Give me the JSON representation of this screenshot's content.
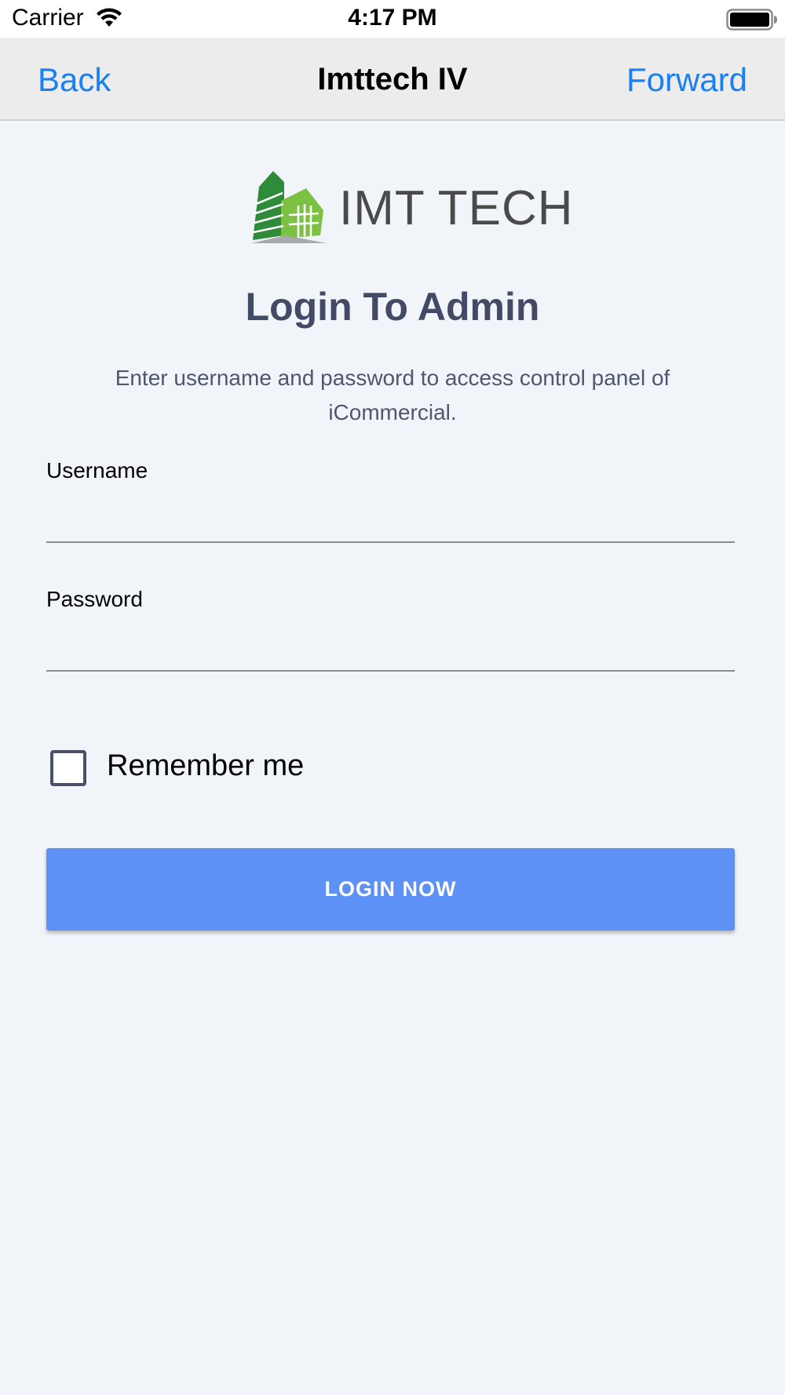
{
  "status_bar": {
    "carrier": "Carrier",
    "time": "4:17 PM"
  },
  "nav": {
    "back_label": "Back",
    "title": "Imttech IV",
    "forward_label": "Forward",
    "tint_color": "#1a7ff0"
  },
  "logo": {
    "text": "IMT TECH",
    "brand_green": "#2e8b3a",
    "brand_light_green": "#7cc242"
  },
  "login": {
    "heading": "Login To Admin",
    "description": "Enter username and password to access control panel of iCommercial.",
    "username_label": "Username",
    "username_value": "",
    "password_label": "Password",
    "password_value": "",
    "remember_label": "Remember me",
    "remember_checked": false,
    "button_label": "LOGIN NOW",
    "button_color": "#5e91f5"
  }
}
